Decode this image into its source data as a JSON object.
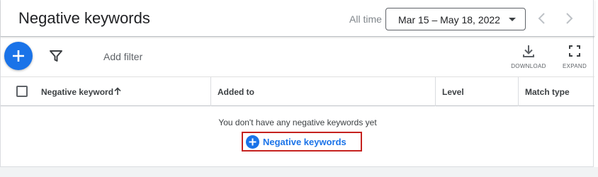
{
  "header": {
    "title": "Negative keywords",
    "date_range_label": "All time",
    "date_range_value": "Mar 15 – May 18, 2022"
  },
  "toolbar": {
    "add_filter_label": "Add filter",
    "download_label": "DOWNLOAD",
    "expand_label": "EXPAND"
  },
  "table": {
    "columns": [
      "Negative keyword",
      "Added to",
      "Level",
      "Match type"
    ],
    "sort_direction": "ascending",
    "empty_message": "You don't have any negative keywords yet",
    "add_button_label": "Negative keywords"
  },
  "icons": {
    "fab": "plus-icon",
    "filter": "filter-icon",
    "download": "download-icon",
    "expand": "expand-icon",
    "prev": "chevron-left-icon",
    "next": "chevron-right-icon",
    "sort": "arrow-up-icon"
  },
  "colors": {
    "accent": "#1a73e8",
    "highlight_border": "#c5221f"
  }
}
